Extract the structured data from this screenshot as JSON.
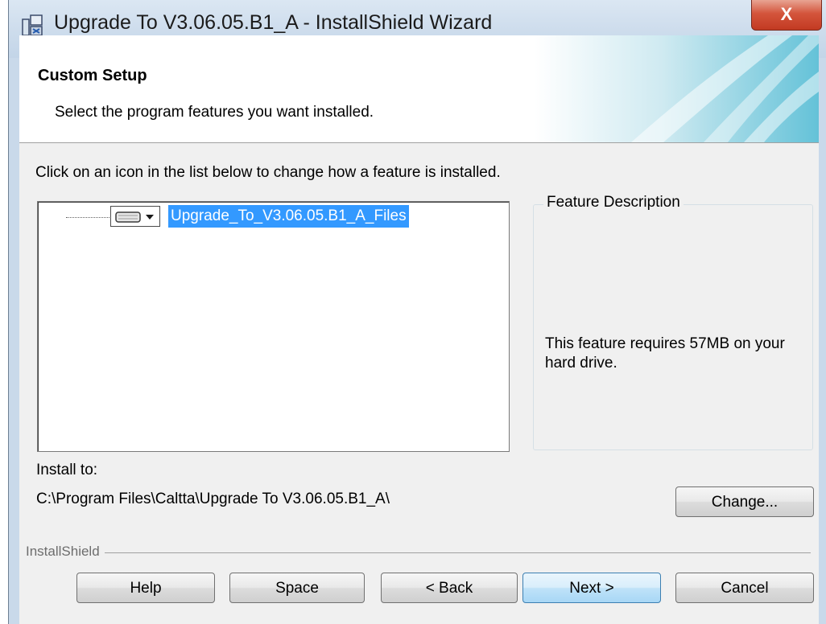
{
  "window": {
    "title": "Upgrade To V3.06.05.B1_A - InstallShield Wizard",
    "close_glyph": "X"
  },
  "header": {
    "title": "Custom Setup",
    "subtitle": "Select the program features you want installed."
  },
  "instruction": "Click on an icon in the list below to change how a feature is installed.",
  "tree": {
    "items": [
      {
        "label": "Upgrade_To_V3.06.05.B1_A_Files",
        "icon": "hard-drive-icon",
        "selected": true
      }
    ]
  },
  "feature_description": {
    "legend": "Feature Description",
    "text": "This feature requires 57MB on your hard drive."
  },
  "install": {
    "label": "Install to:",
    "path": "C:\\Program Files\\Caltta\\Upgrade To V3.06.05.B1_A\\"
  },
  "buttons": {
    "change": "Change...",
    "help": "Help",
    "space": "Space",
    "back": "< Back",
    "next": "Next >",
    "cancel": "Cancel"
  },
  "branding": "InstallShield",
  "colors": {
    "selection": "#3399ff",
    "close_button": "#c9432a",
    "default_button_border": "#3c7fb1"
  }
}
